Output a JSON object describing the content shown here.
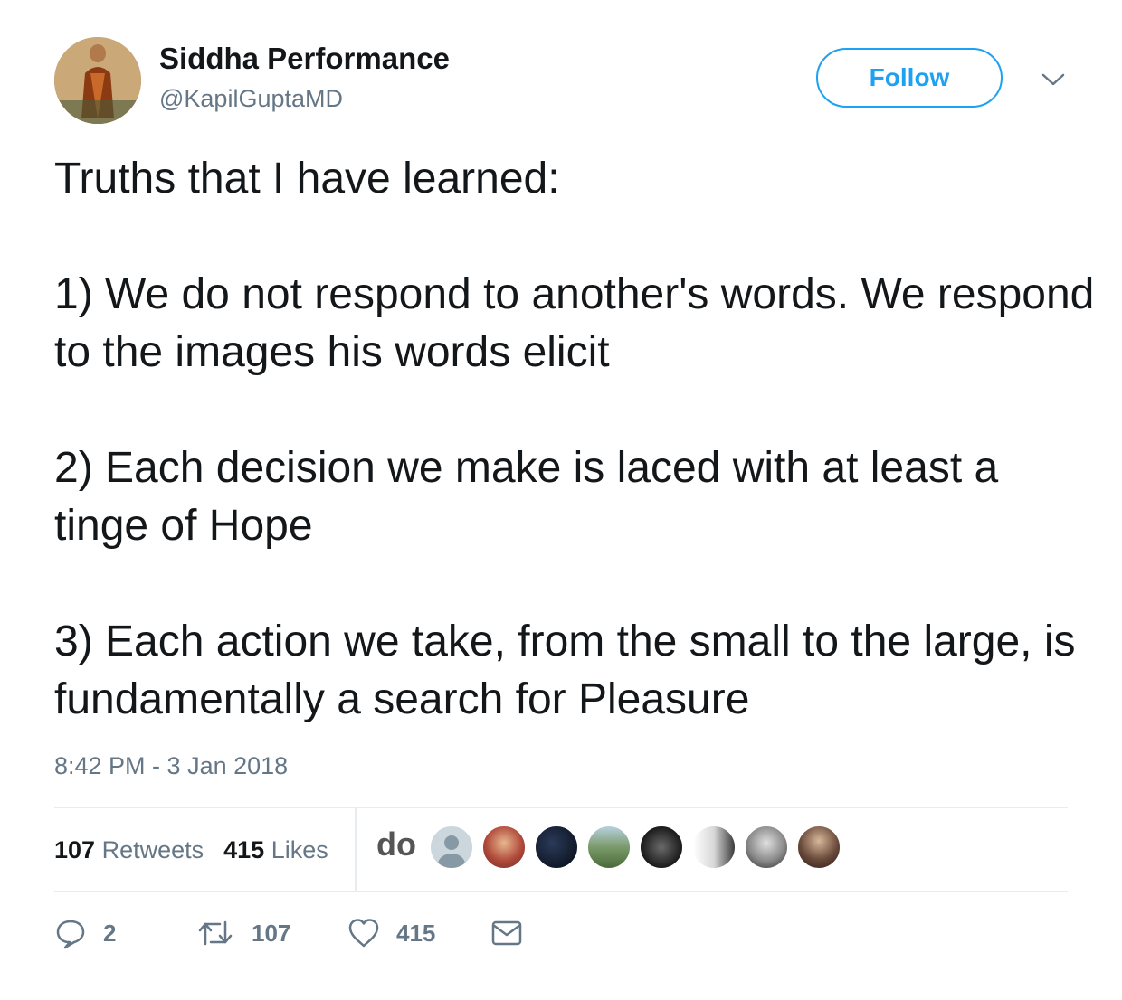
{
  "author": {
    "name": "Siddha Performance",
    "handle": "@KapilGuptaMD"
  },
  "follow_button": {
    "label": "Follow"
  },
  "tweet": {
    "text": "Truths that I have learned:\n\n1) We do not respond to another's words. We respond to the images his words elicit\n\n2) Each decision we make is laced with at least a tinge of Hope\n\n3) Each action we take, from the small to the large, is fundamentally a search for Pleasure",
    "timestamp": "8:42 PM - 3 Jan 2018"
  },
  "stats": {
    "retweets_count": "107",
    "retweets_label": "Retweets",
    "likes_count": "415",
    "likes_label": "Likes"
  },
  "likers": {
    "first_avatar_text": "do",
    "avatars": [
      "default-user-icon",
      "person-avatar",
      "night-sky-avatar",
      "landscape-avatar",
      "network-avatar",
      "face-avatar",
      "elderly-man-avatar",
      "man-with-beard-avatar"
    ]
  },
  "actions": {
    "reply_count": "2",
    "retweet_count": "107",
    "like_count": "415"
  },
  "colors": {
    "accent": "#1da1f2",
    "text": "#14171a",
    "muted": "#657786",
    "divider": "#e6ecf0"
  }
}
